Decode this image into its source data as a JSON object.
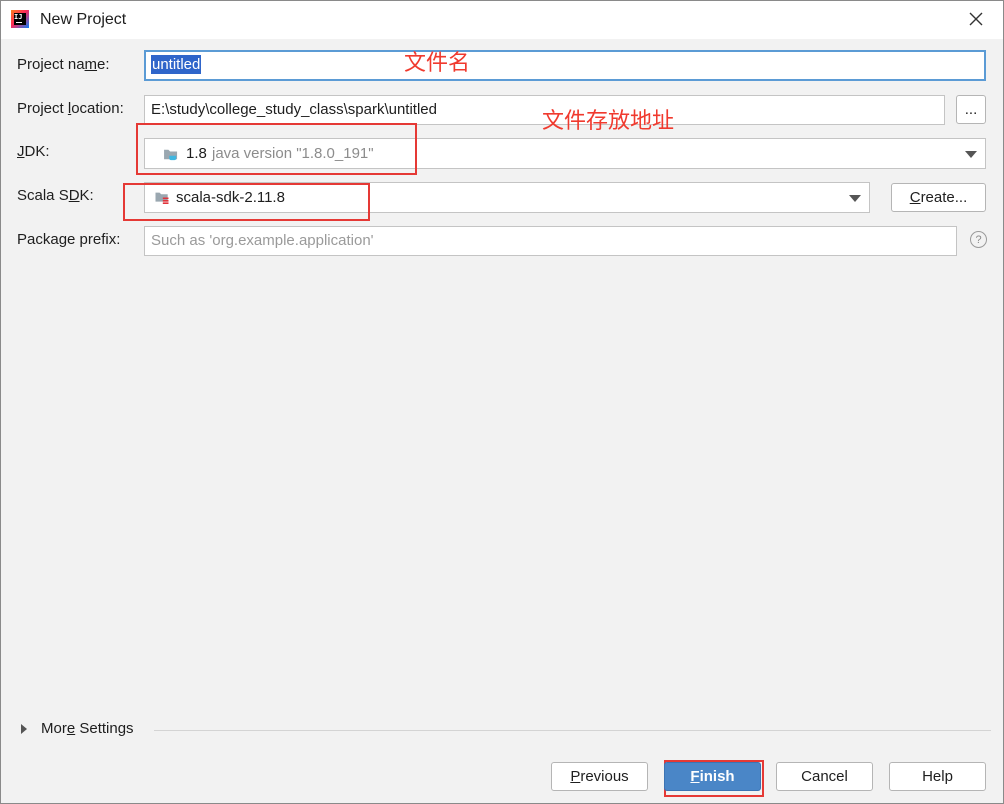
{
  "window": {
    "title": "New Project",
    "app_icon": "intellij-idea-icon",
    "close_icon": "close-icon"
  },
  "form": {
    "project_name": {
      "label_pre": "Project na",
      "label_u": "m",
      "label_post": "e:",
      "value": "untitled"
    },
    "project_location": {
      "label_pre": "Project ",
      "label_u": "l",
      "label_post": "ocation:",
      "value": "E:\\study\\college_study_class\\spark\\untitled",
      "browse_label": "..."
    },
    "jdk": {
      "label_u": "J",
      "label_post": "DK:",
      "version": "1.8",
      "detail": "java version \"1.8.0_191\"",
      "icon": "jdk-folder-icon"
    },
    "scala_sdk": {
      "label_pre": "Scala S",
      "label_u": "D",
      "label_post": "K:",
      "value": "scala-sdk-2.11.8",
      "icon": "scala-folder-icon",
      "create_pre": "",
      "create_u": "C",
      "create_post": "reate..."
    },
    "package_prefix": {
      "label": "Package prefix:",
      "placeholder": "Such as 'org.example.application'",
      "help_glyph": "?"
    }
  },
  "annotations": {
    "file_name": "文件名",
    "file_location": "文件存放地址",
    "highlight_color": "#e53935"
  },
  "more_settings": {
    "pre": "Mor",
    "u": "e",
    "post": " Settings"
  },
  "buttons": {
    "previous": {
      "u": "P",
      "post": "revious"
    },
    "finish": {
      "u": "F",
      "post": "inish"
    },
    "cancel": "Cancel",
    "help": "Help"
  },
  "colors": {
    "accent": "#4a86c7",
    "selection": "#2f65ca",
    "focus_border": "#5b9bd5"
  }
}
